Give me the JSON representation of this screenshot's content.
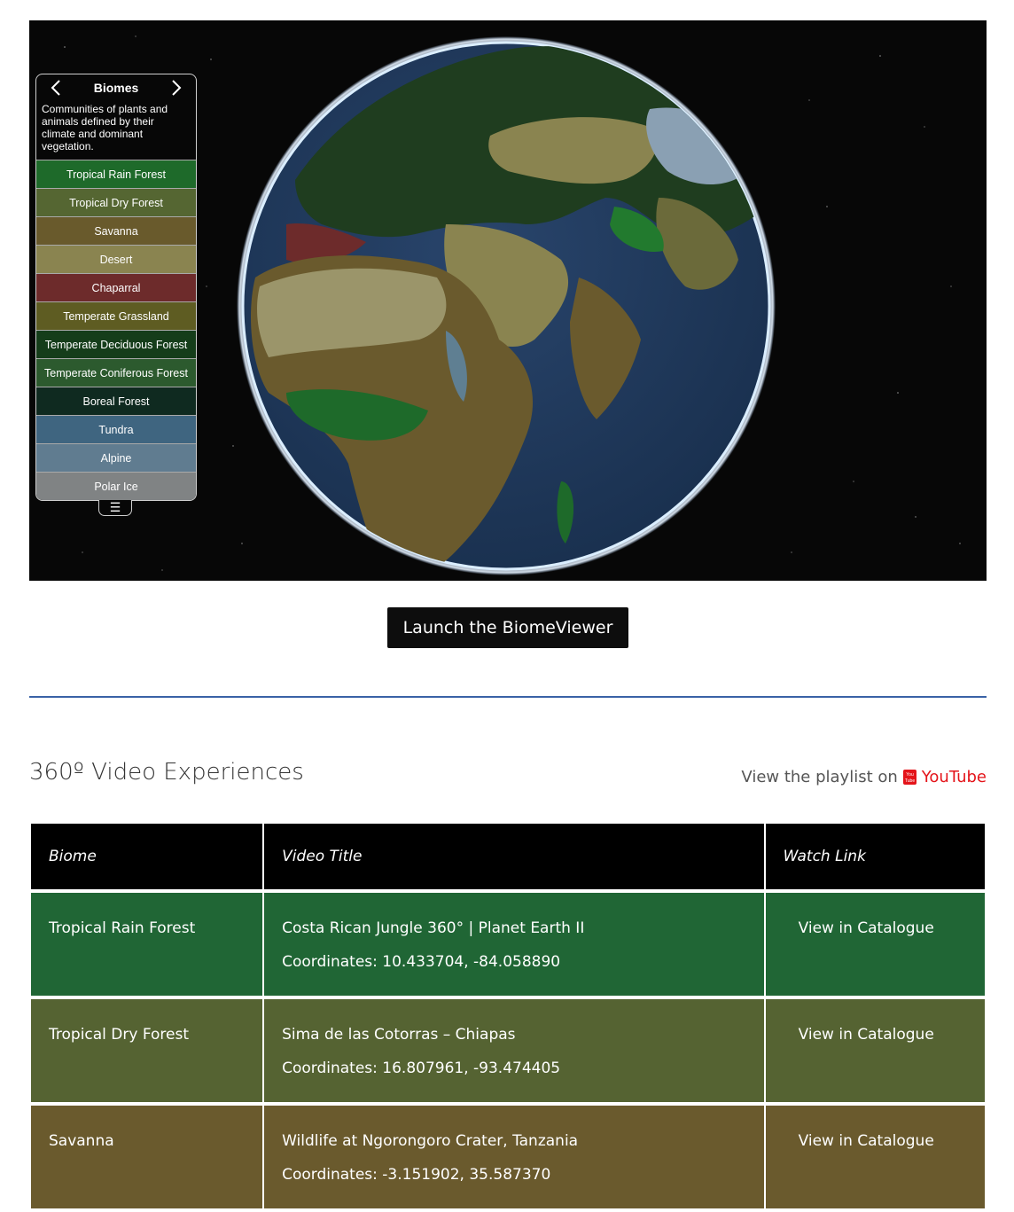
{
  "viewer": {
    "panel_title": "Biomes",
    "panel_description": "Communities of plants and animals defined by their climate and dominant vegetation.",
    "prev_icon": "chevron-left-icon",
    "next_icon": "chevron-right-icon",
    "menu_icon": "hamburger-icon",
    "biomes": [
      {
        "label": "Tropical Rain Forest",
        "color": "#1e6a2a"
      },
      {
        "label": "Tropical Dry Forest",
        "color": "#556632"
      },
      {
        "label": "Savanna",
        "color": "#695a2c"
      },
      {
        "label": "Desert",
        "color": "#8a8450"
      },
      {
        "label": "Chaparral",
        "color": "#6d2b2b"
      },
      {
        "label": "Temperate Grassland",
        "color": "#5e5c22"
      },
      {
        "label": "Temperate Deciduous Forest",
        "color": "#153d1a"
      },
      {
        "label": "Temperate Coniferous Forest",
        "color": "#2c5a2e"
      },
      {
        "label": "Boreal Forest",
        "color": "#0f2a20"
      },
      {
        "label": "Tundra",
        "color": "#3f6580"
      },
      {
        "label": "Alpine",
        "color": "#607c90"
      },
      {
        "label": "Polar Ice",
        "color": "#808384"
      }
    ]
  },
  "launch_button": "Launch the BiomeViewer",
  "videos_section": {
    "title": "360º Video Experiences",
    "playlist_prefix": "View the playlist on",
    "playlist_link": "YouTube",
    "youtube_icon": "youtube-icon",
    "youtube_color": "#e4141a",
    "headers": [
      "Biome",
      "Video Title",
      "Watch Link"
    ],
    "rows": [
      {
        "biome": "Tropical Rain Forest",
        "title": "Costa Rican Jungle 360° | Planet Earth II",
        "coords": "Coordinates: 10.433704, -84.058890",
        "link": "View in Catalogue",
        "color": "#206635"
      },
      {
        "biome": "Tropical Dry Forest",
        "title": "Sima de las Cotorras – Chiapas",
        "coords": "Coordinates: 16.807961, -93.474405",
        "link": "View in Catalogue",
        "color": "#556332"
      },
      {
        "biome": "Savanna",
        "title": "Wildlife at Ngorongoro Crater, Tanzania",
        "coords": "Coordinates: -3.151902, 35.587370",
        "link": "View in Catalogue",
        "color": "#6a5a2d"
      }
    ]
  }
}
